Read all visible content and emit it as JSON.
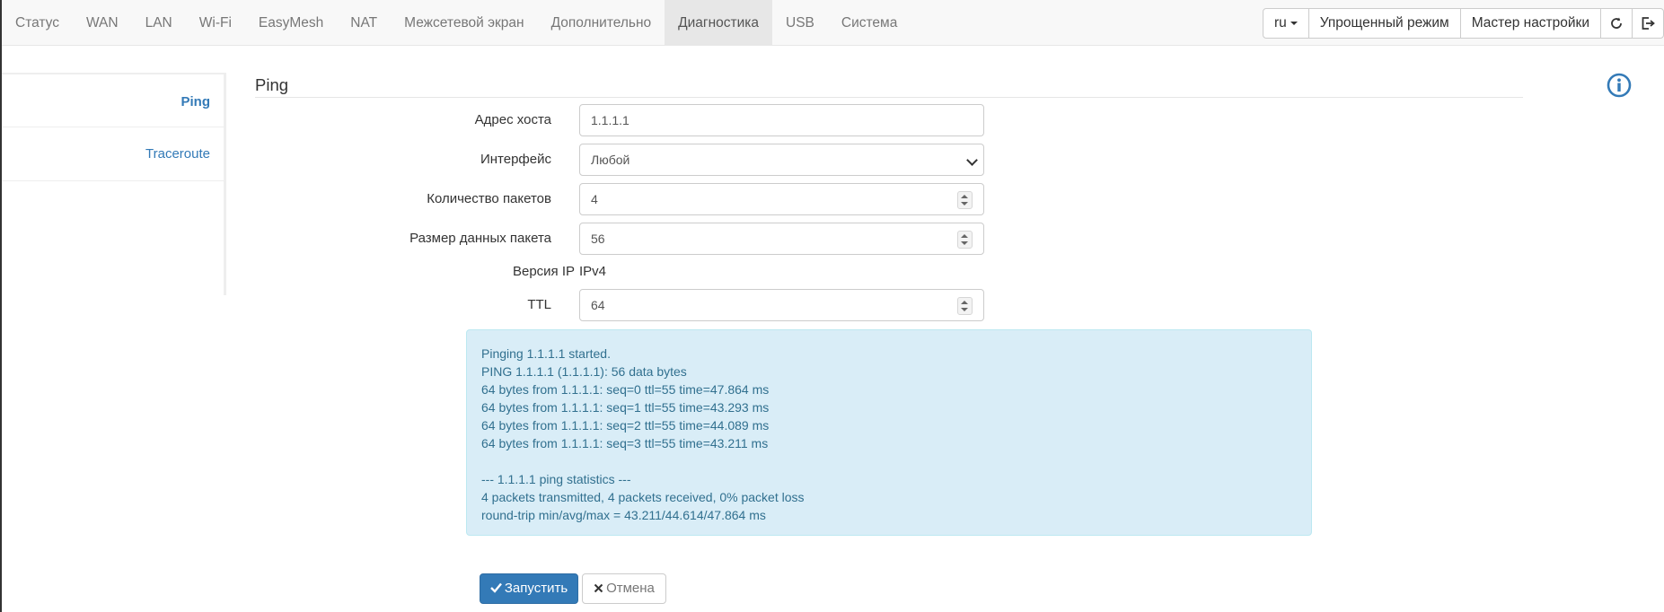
{
  "nav": {
    "tabs": [
      {
        "label": "Статус"
      },
      {
        "label": "WAN"
      },
      {
        "label": "LAN"
      },
      {
        "label": "Wi-Fi"
      },
      {
        "label": "EasyMesh"
      },
      {
        "label": "NAT"
      },
      {
        "label": "Межсетевой экран"
      },
      {
        "label": "Дополнительно"
      },
      {
        "label": "Диагностика"
      },
      {
        "label": "USB"
      },
      {
        "label": "Система"
      }
    ],
    "active_tab": "Диагностика",
    "language": "ru",
    "simple_mode": "Упрощенный режим",
    "wizard": "Мастер настройки",
    "refresh_icon": "refresh-icon",
    "logout_icon": "logout-icon"
  },
  "sidebar": {
    "items": [
      {
        "label": "Ping"
      },
      {
        "label": "Traceroute"
      }
    ]
  },
  "main": {
    "title": "Ping",
    "info_icon": "info-icon",
    "accent_color": "#337ab7",
    "fields": {
      "host": {
        "label": "Адрес хоста",
        "value": "1.1.1.1"
      },
      "interface": {
        "label": "Интерфейс",
        "value": "Любой"
      },
      "count": {
        "label": "Количество пакетов",
        "value": "4"
      },
      "size": {
        "label": "Размер данных пакета",
        "value": "56"
      },
      "ip_version": {
        "label": "Версия IP",
        "value": "IPv4"
      },
      "ttl": {
        "label": "TTL",
        "value": "64"
      }
    },
    "output_lines": [
      "Pinging 1.1.1.1 started.",
      "PING 1.1.1.1 (1.1.1.1): 56 data bytes",
      "64 bytes from 1.1.1.1: seq=0 ttl=55 time=47.864 ms",
      "64 bytes from 1.1.1.1: seq=1 ttl=55 time=43.293 ms",
      "64 bytes from 1.1.1.1: seq=2 ttl=55 time=44.089 ms",
      "64 bytes from 1.1.1.1: seq=3 ttl=55 time=43.211 ms",
      "",
      "--- 1.1.1.1 ping statistics ---",
      "4 packets transmitted, 4 packets received, 0% packet loss",
      "round-trip min/avg/max = 43.211/44.614/47.864 ms"
    ],
    "run_label": "Запустить",
    "cancel_label": "Отмена"
  }
}
